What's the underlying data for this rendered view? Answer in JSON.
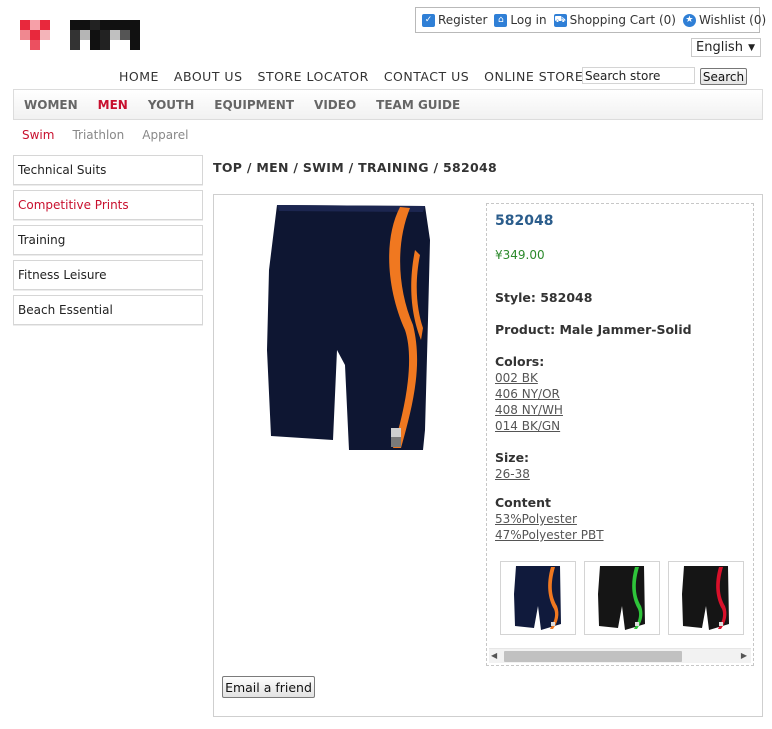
{
  "account": {
    "register": "Register",
    "login": "Log in",
    "cart": "Shopping Cart (0)",
    "wishlist": "Wishlist (0)"
  },
  "language": "English",
  "top_nav": [
    "HOME",
    "ABOUT US",
    "STORE LOCATOR",
    "CONTACT US",
    "ONLINE STORE"
  ],
  "search": {
    "value": "Search store",
    "button": "Search"
  },
  "categories": [
    {
      "label": "WOMEN",
      "active": false
    },
    {
      "label": "MEN",
      "active": true
    },
    {
      "label": "YOUTH",
      "active": false
    },
    {
      "label": "EQUIPMENT",
      "active": false
    },
    {
      "label": "VIDEO",
      "active": false
    },
    {
      "label": "TEAM GUIDE",
      "active": false
    }
  ],
  "sub_tabs": [
    {
      "label": "Swim",
      "active": true
    },
    {
      "label": "Triathlon",
      "active": false
    },
    {
      "label": "Apparel",
      "active": false
    }
  ],
  "sidebar": {
    "items": [
      {
        "label": "Technical Suits",
        "active": false
      },
      {
        "label": "Competitive Prints",
        "active": true
      },
      {
        "label": "Training",
        "active": false
      },
      {
        "label": "Fitness Leisure",
        "active": false
      },
      {
        "label": "Beach Essential",
        "active": false
      }
    ]
  },
  "breadcrumb": "TOP / MEN / SWIM / TRAINING / 582048",
  "product": {
    "code": "582048",
    "price": "¥349.00",
    "style": "Style: 582048",
    "name": "Product: Male Jammer-Solid",
    "colors_label": "Colors:",
    "colors": [
      "002 BK",
      "406 NY/OR",
      "408 NY/WH",
      "014 BK/GN"
    ],
    "size_label": "Size:",
    "size": "26-38",
    "content_label": "Content",
    "content": [
      "53%Polyester",
      "47%Polyester PBT"
    ],
    "thumb_accents": [
      "#f07820",
      "#2ec43a",
      "#d8102a"
    ],
    "thumb_bases": [
      "#101a3c",
      "#151515",
      "#151515"
    ]
  },
  "colors": {
    "accent_red": "#c8102e",
    "link_blue": "#2b5d8c",
    "price_green": "#2c8a2c",
    "suit_navy": "#0e1632",
    "suit_orange": "#f07820"
  },
  "email_button": "Email a friend"
}
